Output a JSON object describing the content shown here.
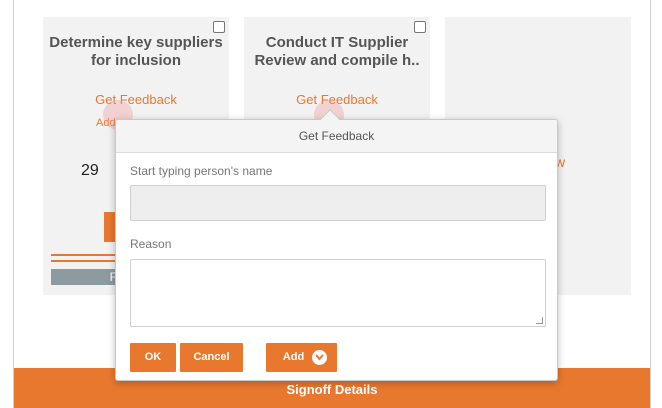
{
  "cards": [
    {
      "title": "Determine key suppliers for inclusion",
      "feedback_link": "Get Feedback",
      "add_partial": "Add",
      "number_partial": "29",
      "footer_partial": "F"
    },
    {
      "title": "Conduct IT Supplier Review and compile h..",
      "feedback_link": "Get Feedback"
    },
    {}
  ],
  "side_link_partial": "w",
  "signoff": {
    "label": "Signoff Details"
  },
  "modal": {
    "title": "Get Feedback",
    "name_label": "Start typing person's name",
    "name_value": "",
    "reason_label": "Reason",
    "reason_value": "",
    "buttons": {
      "ok": "OK",
      "cancel": "Cancel",
      "add": "Add"
    }
  },
  "colors": {
    "accent": "#e8782e",
    "card_bg": "#f2f2f2",
    "footer_grey": "#8d9aa0"
  }
}
